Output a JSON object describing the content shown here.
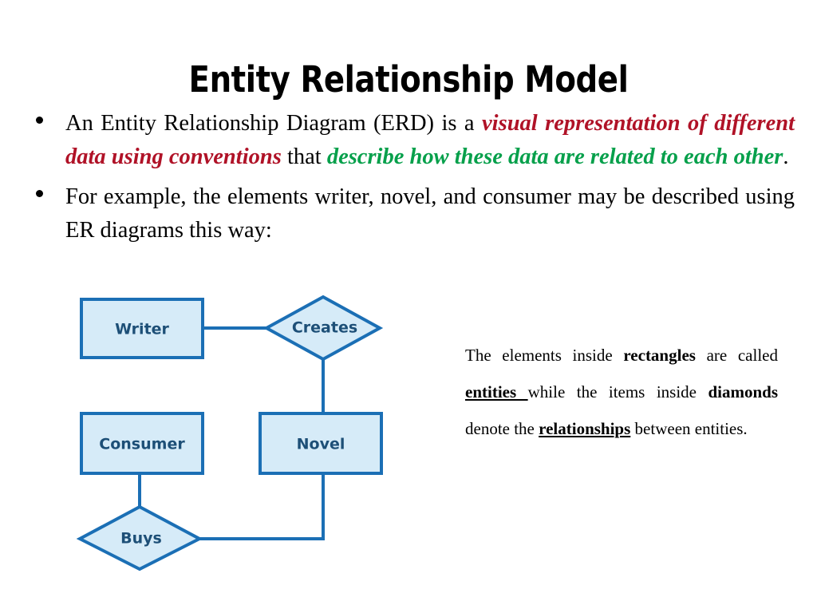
{
  "slide": {
    "title": "Entity Relationship Model",
    "background_color": "#ffffff"
  },
  "colors": {
    "title_text": "#000000",
    "body_text": "#000000",
    "emphasis_red": "#b01227",
    "emphasis_green": "#06a04b",
    "shape_fill": "#d6ebf8",
    "shape_border": "#1b6fb5",
    "shape_label": "#1d4f77"
  },
  "bullets": [
    {
      "marker": "bullet-dot",
      "segments": [
        {
          "text": "An Entity Relationship Diagram (ERD) is a ",
          "style": "plain"
        },
        {
          "text": "visual representation of different data using conventions",
          "style": "red-bold-italic"
        },
        {
          "text": " that ",
          "style": "plain"
        },
        {
          "text": "describe how these data are related to each other",
          "style": "green-bold-italic"
        },
        {
          "text": ".",
          "style": "plain"
        }
      ]
    },
    {
      "marker": "bullet-dot",
      "segments": [
        {
          "text": "For example, the elements writer, novel, and consumer may be described using ER diagrams this way:",
          "style": "plain"
        }
      ]
    }
  ],
  "diagram": {
    "entities": [
      {
        "id": "writer",
        "label": "Writer",
        "shape": "rectangle"
      },
      {
        "id": "consumer",
        "label": "Consumer",
        "shape": "rectangle"
      },
      {
        "id": "novel",
        "label": "Novel",
        "shape": "rectangle"
      }
    ],
    "relationships": [
      {
        "id": "creates",
        "label": "Creates",
        "shape": "diamond"
      },
      {
        "id": "buys",
        "label": "Buys",
        "shape": "diamond"
      }
    ],
    "connections": [
      {
        "from": "writer",
        "to": "creates"
      },
      {
        "from": "creates",
        "to": "novel"
      },
      {
        "from": "consumer",
        "to": "buys"
      },
      {
        "from": "buys",
        "to": "novel"
      }
    ]
  },
  "caption": {
    "segments": [
      {
        "text": "The elements inside ",
        "style": "plain"
      },
      {
        "text": "rectangles",
        "style": "bold"
      },
      {
        "text": " are called ",
        "style": "plain"
      },
      {
        "text": "entities ",
        "style": "bold-underline"
      },
      {
        "text": "while the items inside ",
        "style": "plain"
      },
      {
        "text": "diamonds",
        "style": "bold"
      },
      {
        "text": " denote the ",
        "style": "plain"
      },
      {
        "text": "relationships",
        "style": "bold-underline"
      },
      {
        "text": " between entities.",
        "style": "plain"
      }
    ]
  }
}
